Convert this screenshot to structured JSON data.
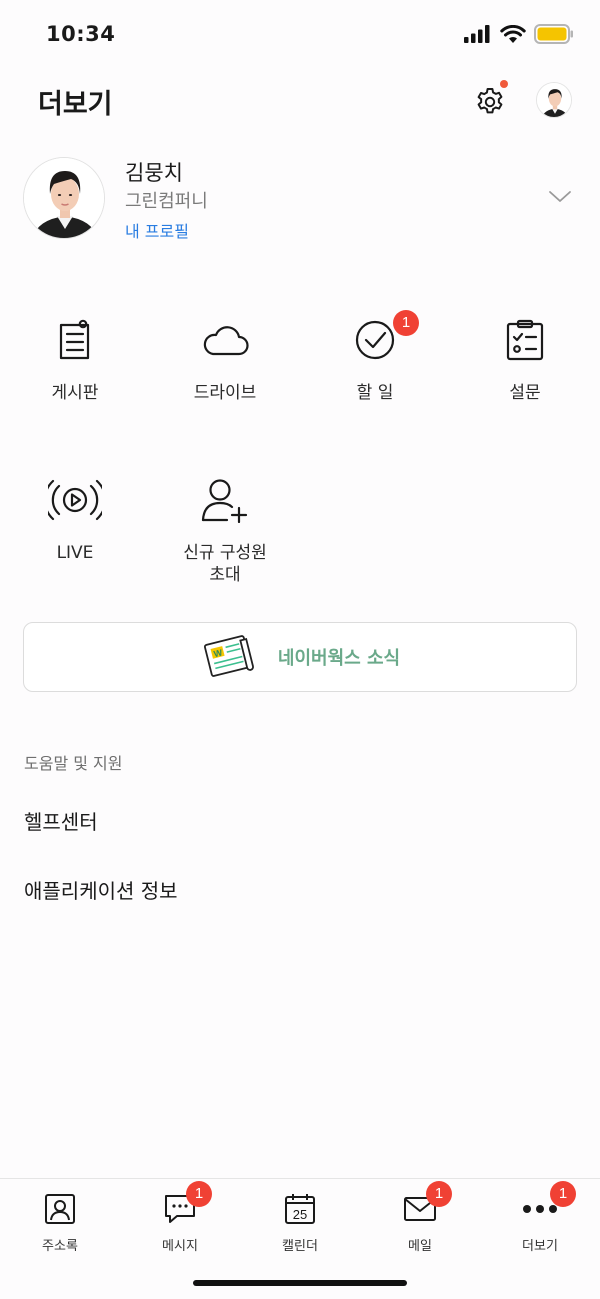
{
  "status": {
    "time": "10:34"
  },
  "header": {
    "title": "더보기"
  },
  "profile": {
    "name": "김뭉치",
    "company": "그린컴퍼니",
    "link": "내 프로필"
  },
  "menu": [
    {
      "label": "게시판",
      "icon": "board-icon",
      "badge": ""
    },
    {
      "label": "드라이브",
      "icon": "cloud-icon",
      "badge": ""
    },
    {
      "label": "할 일",
      "icon": "todo-check-icon",
      "badge": "1"
    },
    {
      "label": "설문",
      "icon": "survey-clipboard-icon",
      "badge": ""
    },
    {
      "label": "LIVE",
      "icon": "live-broadcast-icon",
      "badge": ""
    },
    {
      "label": "신규 구성원\n초대",
      "icon": "invite-member-icon",
      "badge": ""
    }
  ],
  "news": {
    "label": "네이버웍스 소식"
  },
  "help": {
    "header": "도움말 및 지원",
    "items": [
      "헬프센터",
      "애플리케이션 정보"
    ]
  },
  "tabs": [
    {
      "label": "주소록",
      "icon": "contacts-icon",
      "badge": ""
    },
    {
      "label": "메시지",
      "icon": "message-icon",
      "badge": "1"
    },
    {
      "label": "캘린더",
      "icon": "calendar-icon",
      "badge": "",
      "date": "25"
    },
    {
      "label": "메일",
      "icon": "mail-icon",
      "badge": "1"
    },
    {
      "label": "더보기",
      "icon": "more-icon",
      "badge": "1"
    }
  ],
  "colors": {
    "badge": "#f04134",
    "link": "#2a7de1",
    "news_text": "#6aa98a",
    "battery": "#f5c400"
  }
}
